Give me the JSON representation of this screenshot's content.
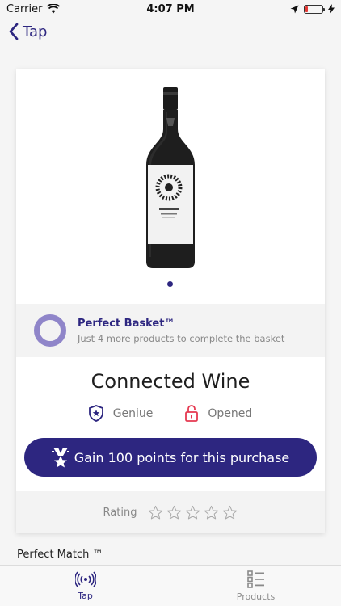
{
  "status": {
    "carrier": "Carrier",
    "time": "4:07 PM",
    "battery_level": 0.15
  },
  "nav": {
    "back_label": "Tap"
  },
  "product": {
    "image_count": 1,
    "active_image": 1,
    "basket": {
      "title": "Perfect Basket™",
      "subtitle": "Just 4 more products to complete the basket"
    },
    "name": "Connected Wine",
    "badges": [
      {
        "label": "Geniue",
        "icon": "shield-star-icon"
      },
      {
        "label": "Opened",
        "icon": "lock-open-icon"
      }
    ],
    "cta_label": "Gain 100 points for this purchase",
    "rating_label": "Rating",
    "rating_value": 0,
    "rating_max": 5
  },
  "section": {
    "perfect_match": "Perfect Match ™"
  },
  "tabbar": {
    "tabs": [
      {
        "label": "Tap",
        "icon": "nfc-signal-icon",
        "active": true
      },
      {
        "label": "Products",
        "icon": "list-icon",
        "active": false
      }
    ]
  },
  "colors": {
    "accent": "#2d2680",
    "ring": "#8f85c9",
    "opened": "#e53950"
  }
}
